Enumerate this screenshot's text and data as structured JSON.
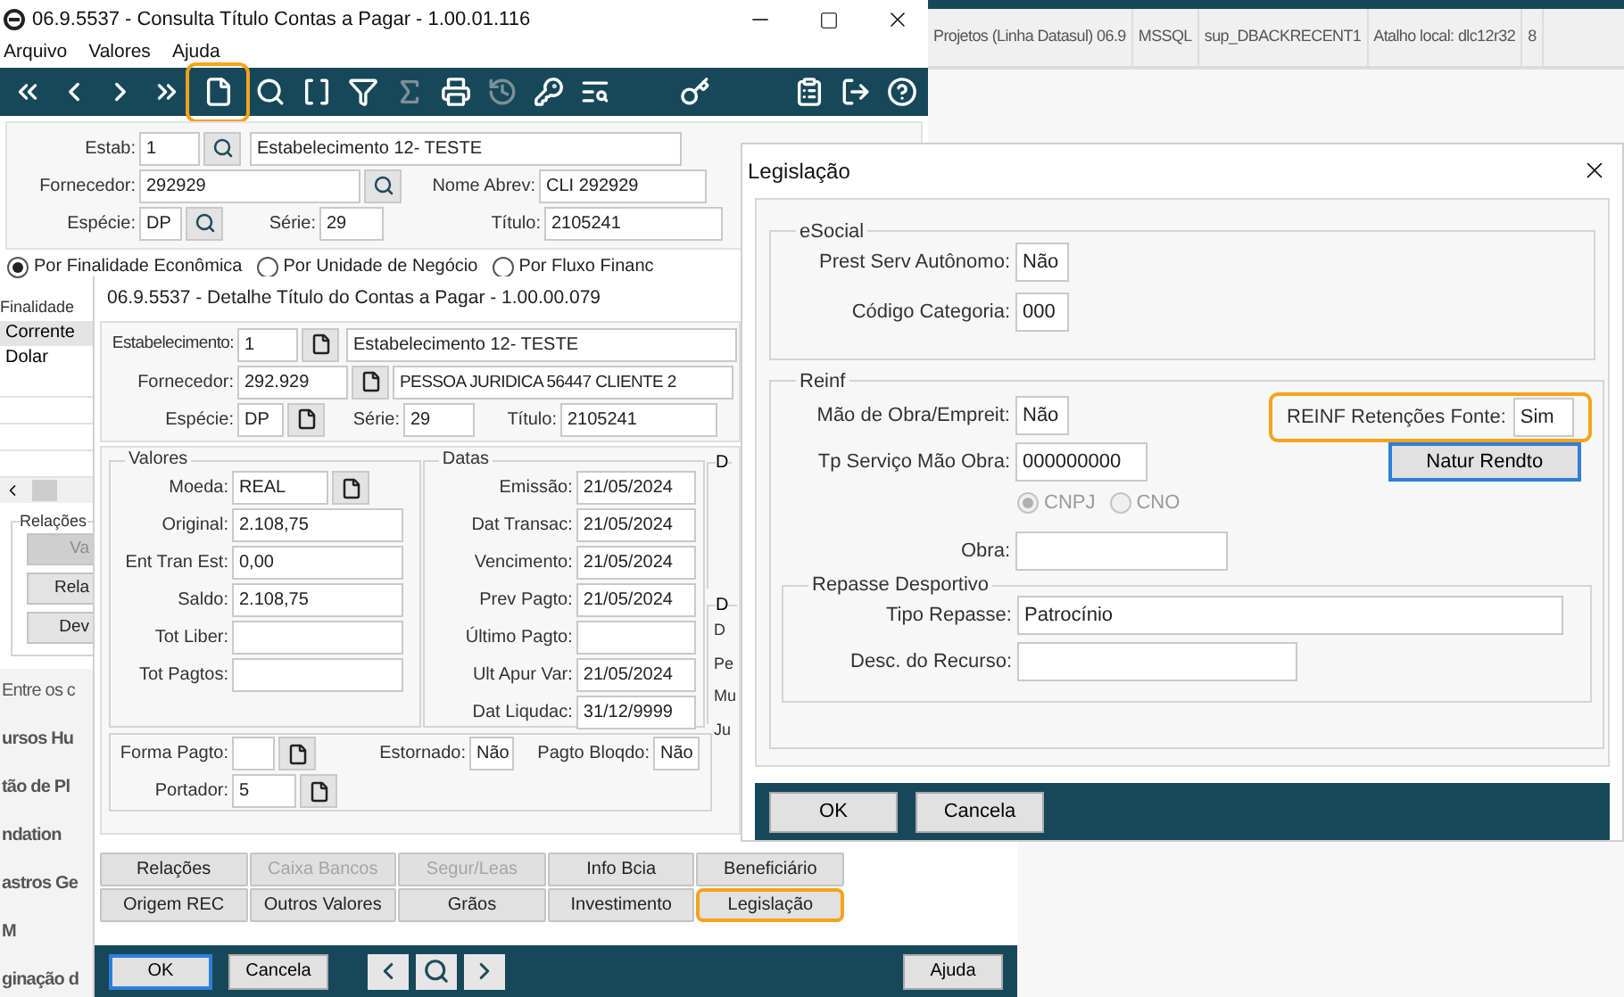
{
  "background_app": {
    "status_cells": [
      "Projetos (Linha Datasul) 06.9",
      "MSSQL",
      "sup_DBACKRECENT1",
      "Atalho local: dlc12r32",
      "8"
    ],
    "menu_fragments": [
      "Entre os c",
      "ursos Hu",
      "tão de Pl",
      "ndation",
      "astros Ge",
      "M",
      "ginação d"
    ]
  },
  "main_window": {
    "title": "06.9.5537 - Consulta Título Contas a Pagar - 1.00.01.116",
    "menu": [
      "Arquivo",
      "Valores",
      "Ajuda"
    ],
    "toolbar": [
      [
        {
          "kind": "first",
          "disabled": false,
          "highlighted": false
        },
        {
          "kind": "prev",
          "disabled": false,
          "highlighted": false
        },
        {
          "kind": "next",
          "disabled": false,
          "highlighted": false
        },
        {
          "kind": "last",
          "disabled": false,
          "highlighted": false
        },
        {
          "kind": "new",
          "disabled": false,
          "highlighted": true
        },
        {
          "kind": "search",
          "disabled": false,
          "highlighted": false
        },
        {
          "kind": "brackets",
          "disabled": false,
          "highlighted": false
        },
        {
          "kind": "filter",
          "disabled": false,
          "highlighted": false
        },
        {
          "kind": "sum",
          "disabled": true,
          "highlighted": false
        },
        {
          "kind": "print",
          "disabled": false,
          "highlighted": false
        },
        {
          "kind": "history",
          "disabled": true,
          "highlighted": false
        },
        {
          "kind": "key-search",
          "disabled": false,
          "highlighted": false
        },
        {
          "kind": "list-search",
          "disabled": false,
          "highlighted": false
        }
      ],
      [
        {
          "kind": "key",
          "disabled": false,
          "highlighted": false
        }
      ],
      [
        {
          "kind": "clipboard",
          "disabled": false,
          "highlighted": false
        },
        {
          "kind": "exit",
          "disabled": false,
          "highlighted": false
        },
        {
          "kind": "help",
          "disabled": false,
          "highlighted": false
        }
      ]
    ],
    "form": {
      "estab_label": "Estab:",
      "estab": "1",
      "estab_name": "Estabelecimento 12- TESTE",
      "fornecedor_label": "Fornecedor:",
      "fornecedor": "292929",
      "abbr_label": "Nome Abrev:",
      "abbr": "CLI 292929",
      "especie_label": "Espécie:",
      "especie": "DP",
      "serie_label": "Série:",
      "serie": "29",
      "titulo_label": "Título:",
      "titulo": "2105241"
    },
    "radios": [
      {
        "label": "Por Finalidade Econômica",
        "selected": true
      },
      {
        "label": "Por Unidade de Negócio",
        "selected": false
      },
      {
        "label": "Por Fluxo Financ",
        "selected": false
      }
    ],
    "finalidade": {
      "label": "Finalidade",
      "rows": [
        {
          "text": "Corrente",
          "selected": true
        },
        {
          "text": "Dolar",
          "selected": false
        }
      ]
    },
    "relacoes": {
      "title": "Relações",
      "buttons": [
        {
          "label": "Va",
          "disabled": true
        },
        {
          "label": "Rela",
          "disabled": false
        },
        {
          "label": "Dev",
          "disabled": false
        }
      ]
    }
  },
  "detail_window": {
    "title": "06.9.5537 - Detalhe Título do Contas a Pagar - 1.00.00.079",
    "header": {
      "estab_label": "Estabelecimento:",
      "estab": "1",
      "estab_name": "Estabelecimento 12- TESTE",
      "fornecedor_label": "Fornecedor:",
      "fornecedor": "292.929",
      "fornecedor_name": "PESSOA JURIDICA 56447 CLIENTE 2",
      "especie_label": "Espécie:",
      "especie": "DP",
      "serie_label": "Série:",
      "serie": "29",
      "titulo_label": "Título:",
      "titulo": "2105241"
    },
    "valores": {
      "title": "Valores",
      "fields": [
        {
          "label": "Moeda:",
          "value": "REAL",
          "lookup": true
        },
        {
          "label": "Original:",
          "value": "2.108,75",
          "lookup": false
        },
        {
          "label": "Ent Tran Est:",
          "value": "0,00",
          "lookup": false
        },
        {
          "label": "Saldo:",
          "value": "2.108,75",
          "lookup": false
        },
        {
          "label": "Tot Liber:",
          "lookup": false
        },
        {
          "label": "Tot Pagtos:",
          "lookup": false
        }
      ]
    },
    "datas": {
      "title": "Datas",
      "fields": [
        {
          "label": "Emissão:",
          "value": "21/05/2024"
        },
        {
          "label": "Dat Transac:",
          "value": "21/05/2024"
        },
        {
          "label": "Vencimento:",
          "value": "21/05/2024"
        },
        {
          "label": "Prev Pagto:",
          "value": "21/05/2024"
        },
        {
          "label": "Último Pagto:"
        },
        {
          "label": "Ult Apur Var:",
          "value": "21/05/2024"
        },
        {
          "label": "Dat Liqudac:",
          "value": "31/12/9999"
        }
      ]
    },
    "partial_groups": [
      {
        "title": "D"
      },
      {
        "title": "D",
        "labels": [
          "D",
          "Pe",
          "Mu",
          "Ju"
        ]
      }
    ],
    "pagamento": {
      "forma_label": "Forma Pagto:",
      "estornado_label": "Estornado:",
      "estornado": "Não",
      "bloqueado_label": "Pagto Bloqdo:",
      "bloqueado": "Não",
      "portador_label": "Portador:",
      "portador": "5"
    },
    "buttons": [
      [
        {
          "label": "Relações",
          "disabled": false,
          "highlighted": false
        },
        {
          "label": "Caixa Bancos",
          "disabled": true,
          "highlighted": false
        },
        {
          "label": "Segur/Leas",
          "disabled": true,
          "highlighted": false
        },
        {
          "label": "Info Bcia",
          "disabled": false,
          "highlighted": false
        },
        {
          "label": "Beneficiário",
          "disabled": false,
          "highlighted": false
        }
      ],
      [
        {
          "label": "Origem REC",
          "disabled": false,
          "highlighted": false
        },
        {
          "label": "Outros Valores",
          "disabled": false,
          "highlighted": false
        },
        {
          "label": "Grãos",
          "disabled": false,
          "highlighted": false
        },
        {
          "label": "Investimento",
          "disabled": false,
          "highlighted": false
        },
        {
          "label": "Legislação",
          "disabled": false,
          "highlighted": true
        }
      ]
    ],
    "bottom": {
      "ok": {
        "label": "OK",
        "focused": true
      },
      "cancel": {
        "label": "Cancela",
        "focused": false
      },
      "help": "Ajuda"
    }
  },
  "legislacao_dialog": {
    "title": "Legislação",
    "esocial": {
      "title": "eSocial",
      "fields": [
        {
          "label": "Prest Serv Autônomo:",
          "value": "Não"
        },
        {
          "label": "Código Categoria:",
          "value": "000"
        }
      ]
    },
    "reinf": {
      "title": "Reinf",
      "mao_obra": {
        "label": "Mão de Obra/Empreit:",
        "value": "Não"
      },
      "tp_servico": {
        "label": "Tp Serviço Mão Obra:",
        "value": "000000000"
      },
      "retencoes": {
        "label": "REINF Retenções Fonte:",
        "value": "Sim",
        "highlighted": true
      },
      "natur_button": {
        "label": "Natur Rendto",
        "focused": true
      },
      "radios_disabled": true,
      "radios": [
        {
          "label": "CNPJ",
          "selected": true
        },
        {
          "label": "CNO",
          "selected": false
        }
      ],
      "obra_label": "Obra:",
      "repasse": {
        "title": "Repasse Desportivo",
        "fields": [
          {
            "label": "Tipo Repasse:",
            "value": "Patrocínio"
          },
          {
            "label": "Desc. do Recurso:"
          }
        ]
      }
    },
    "buttons": [
      "OK",
      "Cancela"
    ]
  }
}
